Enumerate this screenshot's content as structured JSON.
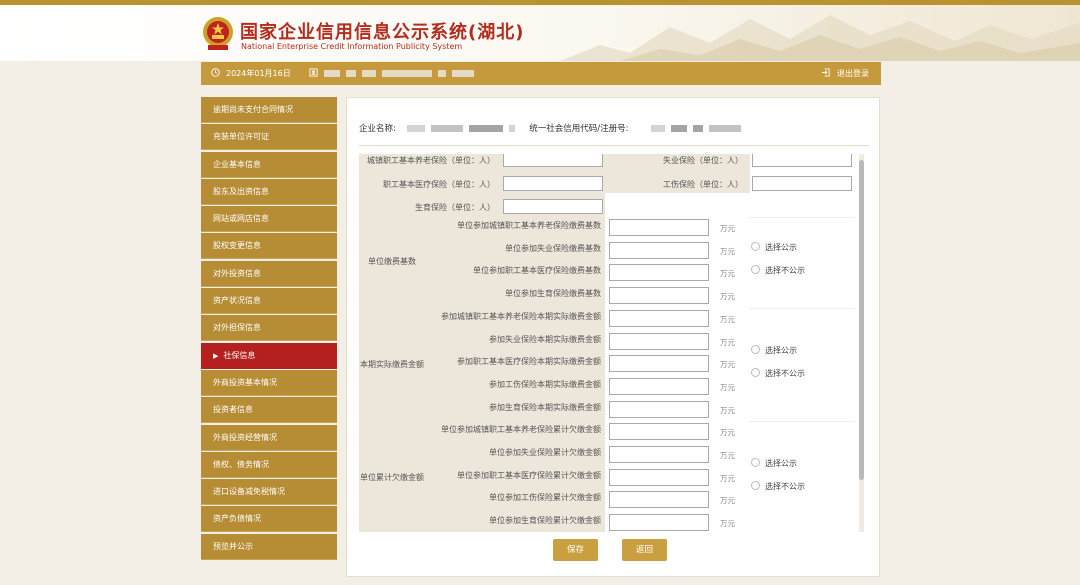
{
  "header": {
    "title": "国家企业信用信息公示系统(湖北)",
    "subtitle": "National Enterprise Credit Information Publicity System"
  },
  "userbar": {
    "date": "2024年01月16日",
    "logout": "退出登录"
  },
  "sidebar": {
    "items": [
      {
        "label": "逾期尚未支付合同情况",
        "active": false
      },
      {
        "label": "充装单位许可证",
        "active": false
      },
      {
        "label": "企业基本信息",
        "active": false
      },
      {
        "label": "股东及出资信息",
        "active": false
      },
      {
        "label": "网站或网店信息",
        "active": false
      },
      {
        "label": "股权变更信息",
        "active": false
      },
      {
        "label": "对外投资信息",
        "active": false
      },
      {
        "label": "资产状况信息",
        "active": false
      },
      {
        "label": "对外担保信息",
        "active": false
      },
      {
        "label": "社保信息",
        "active": true
      },
      {
        "label": "外商投资基本情况",
        "active": false
      },
      {
        "label": "投资者信息",
        "active": false
      },
      {
        "label": "外商投资经营情况",
        "active": false
      },
      {
        "label": "债权、债务情况",
        "active": false
      },
      {
        "label": "进口设备减免税情况",
        "active": false
      },
      {
        "label": "资产负债情况",
        "active": false
      },
      {
        "label": "预览并公示",
        "active": false
      }
    ]
  },
  "company": {
    "name_label": "企业名称:",
    "code_label": "统一社会信用代码/注册号:"
  },
  "insured": {
    "left": [
      "城镇职工基本养老保险（单位：人）",
      "职工基本医疗保险（单位：人）",
      "生育保险（单位：人）"
    ],
    "right": [
      "失业保险（单位：人）",
      "工伤保险（单位：人）"
    ]
  },
  "groups": [
    {
      "label": "单位缴费基数",
      "items": [
        "单位参加城镇职工基本养老保险缴费基数",
        "单位参加失业保险缴费基数",
        "单位参加职工基本医疗保险缴费基数",
        "单位参加生育保险缴费基数"
      ]
    },
    {
      "label": "本期实际缴费金额",
      "items": [
        "参加城镇职工基本养老保险本期实际缴费金额",
        "参加失业保险本期实际缴费金额",
        "参加职工基本医疗保险本期实际缴费金额",
        "参加工伤保险本期实际缴费金额",
        "参加生育保险本期实际缴费金额"
      ]
    },
    {
      "label": "单位累计欠缴金额",
      "items": [
        "单位参加城镇职工基本养老保险累计欠缴金额",
        "单位参加失业保险累计欠缴金额",
        "单位参加职工基本医疗保险累计欠缴金额",
        "单位参加工伤保险累计欠缴金额",
        "单位参加生育保险累计欠缴金额"
      ]
    }
  ],
  "unit": "万元",
  "radio": {
    "publish": "选择公示",
    "no_publish": "选择不公示"
  },
  "buttons": {
    "save": "保存",
    "back": "返回"
  }
}
